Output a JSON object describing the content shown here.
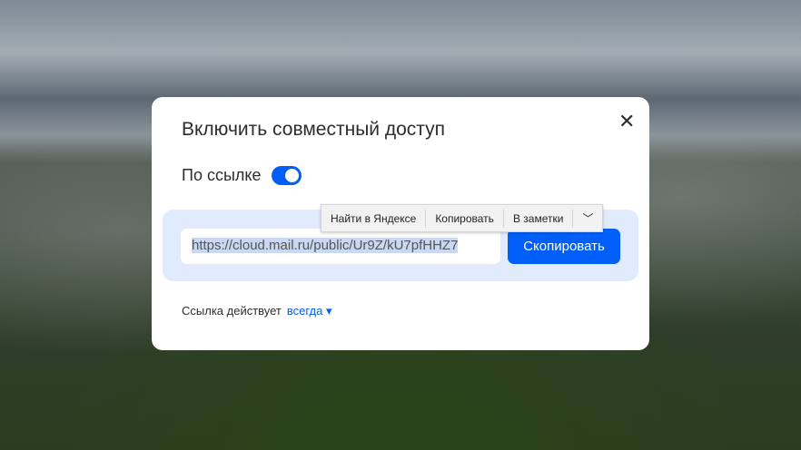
{
  "dialog": {
    "title": "Включить совместный доступ",
    "close": "✕",
    "toggle_label": "По ссылке",
    "toggle_on": true,
    "link": "https://cloud.mail.ru/public/Ur9Z/kU7pfHHZ7",
    "copy_button": "Скопировать",
    "expiry_label": "Ссылка действует",
    "expiry_value": "всегда",
    "expiry_caret": "▾"
  },
  "context_menu": {
    "items": [
      "Найти в Яндексе",
      "Копировать",
      "В заметки"
    ],
    "more": "﹀"
  }
}
